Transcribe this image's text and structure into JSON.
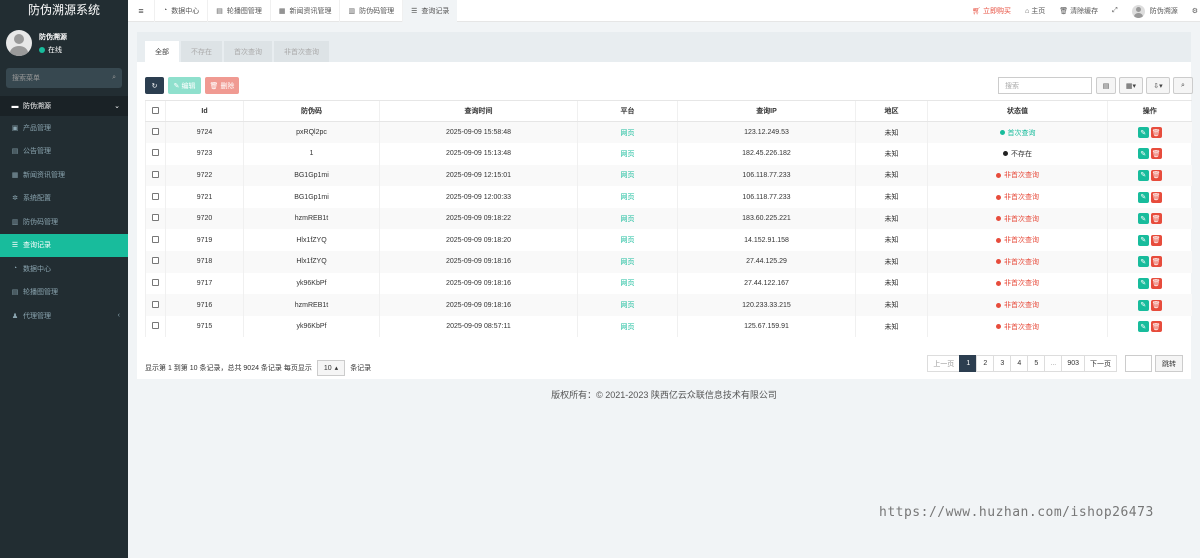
{
  "app": {
    "title": "防伪溯源系统"
  },
  "user": {
    "name": "防伪溯源",
    "status": "在线"
  },
  "sidebar": {
    "search_placeholder": "搜索菜单",
    "group_label": "防伪溯源",
    "items": [
      {
        "label": "产品管理",
        "icon": "cube-icon",
        "glyph": "▣"
      },
      {
        "label": "公告管理",
        "icon": "document-icon",
        "glyph": "▤"
      },
      {
        "label": "新闻资讯管理",
        "icon": "list-icon",
        "glyph": "▦"
      },
      {
        "label": "系统配置",
        "icon": "gear-icon",
        "glyph": "✲"
      },
      {
        "label": "防伪码管理",
        "icon": "code-icon",
        "glyph": "▥"
      },
      {
        "label": "查询记录",
        "icon": "list-icon",
        "glyph": "☰"
      },
      {
        "label": "数据中心",
        "icon": "dashboard-icon",
        "glyph": "◔"
      },
      {
        "label": "轮播图管理",
        "icon": "image-icon",
        "glyph": "▤"
      },
      {
        "label": "代理管理",
        "icon": "users-icon",
        "glyph": "♟"
      }
    ]
  },
  "topbar": {
    "tabs": [
      {
        "label": "数据中心",
        "glyph": "◔"
      },
      {
        "label": "轮播图管理",
        "glyph": "▤"
      },
      {
        "label": "新闻资讯管理",
        "glyph": "▦"
      },
      {
        "label": "防伪码管理",
        "glyph": "▥"
      },
      {
        "label": "查询记录",
        "glyph": "☰"
      }
    ],
    "buy_label": "立即购买",
    "home_label": "主页",
    "clear_cache_label": "清除缓存",
    "username": "防伪溯源"
  },
  "filters": [
    "全部",
    "不存在",
    "首次查询",
    "非首次查询"
  ],
  "toolbar": {
    "edit_label": "编辑",
    "delete_label": "删除",
    "search_placeholder": "搜索"
  },
  "table": {
    "headers": [
      "Id",
      "防伪码",
      "查询时间",
      "平台",
      "查询IP",
      "地区",
      "状态值",
      "操作"
    ],
    "rows": [
      {
        "id": "9724",
        "code": "pxRQl2pc",
        "time": "2025-09-09 15:58:48",
        "platform": "网页",
        "ip": "123.12.249.53",
        "region": "未知",
        "status": "首次查询",
        "status_color": "#18bc9c"
      },
      {
        "id": "9723",
        "code": "1",
        "time": "2025-09-09 15:13:48",
        "platform": "网页",
        "ip": "182.45.226.182",
        "region": "未知",
        "status": "不存在",
        "status_color": "#222222"
      },
      {
        "id": "9722",
        "code": "BG1Gp1mi",
        "time": "2025-09-09 12:15:01",
        "platform": "网页",
        "ip": "106.118.77.233",
        "region": "未知",
        "status": "非首次查询",
        "status_color": "#e74c3c"
      },
      {
        "id": "9721",
        "code": "BG1Gp1mi",
        "time": "2025-09-09 12:00:33",
        "platform": "网页",
        "ip": "106.118.77.233",
        "region": "未知",
        "status": "非首次查询",
        "status_color": "#e74c3c"
      },
      {
        "id": "9720",
        "code": "hzmREB1t",
        "time": "2025-09-09 09:18:22",
        "platform": "网页",
        "ip": "183.60.225.221",
        "region": "未知",
        "status": "非首次查询",
        "status_color": "#e74c3c"
      },
      {
        "id": "9719",
        "code": "Hlx1fZYQ",
        "time": "2025-09-09 09:18:20",
        "platform": "网页",
        "ip": "14.152.91.158",
        "region": "未知",
        "status": "非首次查询",
        "status_color": "#e74c3c"
      },
      {
        "id": "9718",
        "code": "Hlx1fZYQ",
        "time": "2025-09-09 09:18:16",
        "platform": "网页",
        "ip": "27.44.125.29",
        "region": "未知",
        "status": "非首次查询",
        "status_color": "#e74c3c"
      },
      {
        "id": "9717",
        "code": "yk96KbPf",
        "time": "2025-09-09 09:18:16",
        "platform": "网页",
        "ip": "27.44.122.167",
        "region": "未知",
        "status": "非首次查询",
        "status_color": "#e74c3c"
      },
      {
        "id": "9716",
        "code": "hzmREB1t",
        "time": "2025-09-09 09:18:16",
        "platform": "网页",
        "ip": "120.233.33.215",
        "region": "未知",
        "status": "非首次查询",
        "status_color": "#e74c3c"
      },
      {
        "id": "9715",
        "code": "yk96KbPf",
        "time": "2025-09-09 08:57:11",
        "platform": "网页",
        "ip": "125.67.159.91",
        "region": "未知",
        "status": "非首次查询",
        "status_color": "#e74c3c"
      }
    ]
  },
  "footer": {
    "summary": "显示第 1 到第 10 条记录，总共 9024 条记录 每页显示",
    "page_size": "10",
    "page_size_suffix": "条记录"
  },
  "pagination": {
    "prev": "上一页",
    "pages": [
      "1",
      "2",
      "3",
      "4",
      "5",
      "...",
      "903"
    ],
    "next": "下一页",
    "go": "跳转"
  },
  "copyright": "版权所有：© 2021-2023 陕西亿云众联信息技术有限公司",
  "watermark_url": "https://www.huzhan.com/ishop26473",
  "colors": {
    "sidebar_bg": "#222d32",
    "accent": "#18bc9c",
    "danger": "#e74c3c",
    "primary": "#2c3e50"
  }
}
